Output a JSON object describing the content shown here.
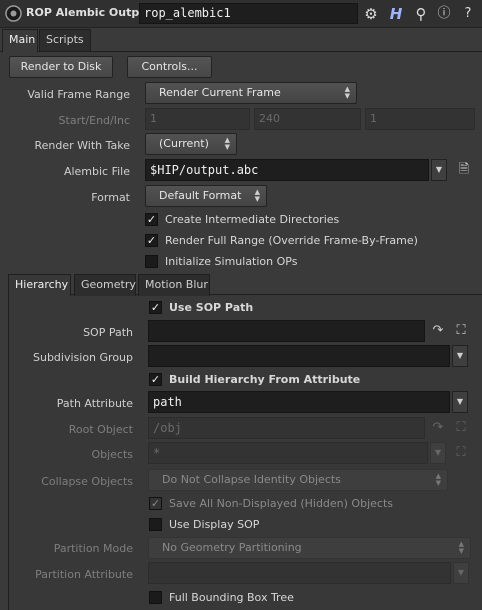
{
  "header": {
    "title": "ROP Alembic Output",
    "node_name": "rop_alembic1"
  },
  "main_tabs": [
    {
      "label": "Main"
    },
    {
      "label": "Scripts"
    }
  ],
  "buttons": {
    "render_to_disk": "Render to Disk",
    "controls": "Controls..."
  },
  "valid_frame_range": {
    "label": "Valid Frame Range",
    "value": "Render Current Frame"
  },
  "start_end_inc": {
    "label": "Start/End/Inc",
    "start": "1",
    "end": "240",
    "inc": "1"
  },
  "render_with_take": {
    "label": "Render With Take",
    "value": "(Current)"
  },
  "alembic_file": {
    "label": "Alembic File",
    "value": "$HIP/output.abc"
  },
  "format": {
    "label": "Format",
    "value": "Default Format"
  },
  "main_checks": [
    {
      "label": "Create Intermediate Directories",
      "checked": true
    },
    {
      "label": "Render Full Range (Override Frame-By-Frame)",
      "checked": true
    },
    {
      "label": "Initialize Simulation OPs",
      "checked": false
    }
  ],
  "sub_tabs": [
    {
      "label": "Hierarchy"
    },
    {
      "label": "Geometry"
    },
    {
      "label": "Motion Blur"
    }
  ],
  "hierarchy": {
    "use_sop_path": {
      "label": "Use SOP Path",
      "checked": true
    },
    "sop_path": {
      "label": "SOP Path",
      "value": ""
    },
    "subdivision_group": {
      "label": "Subdivision Group",
      "value": ""
    },
    "build_hierarchy": {
      "label": "Build Hierarchy From Attribute",
      "checked": true
    },
    "path_attribute": {
      "label": "Path Attribute",
      "value": "path"
    },
    "root_object": {
      "label": "Root Object",
      "value": "/obj"
    },
    "objects": {
      "label": "Objects",
      "value": "*"
    },
    "collapse_objects": {
      "label": "Collapse Objects",
      "value": "Do Not Collapse Identity Objects"
    },
    "save_non_displayed": {
      "label": "Save All Non-Displayed (Hidden) Objects",
      "checked": true
    },
    "use_display_sop": {
      "label": "Use Display SOP",
      "checked": false
    },
    "partition_mode": {
      "label": "Partition Mode",
      "value": "No Geometry Partitioning"
    },
    "partition_attribute": {
      "label": "Partition Attribute",
      "value": ""
    },
    "full_bbox_tree": {
      "label": "Full Bounding Box Tree",
      "checked": false
    }
  }
}
